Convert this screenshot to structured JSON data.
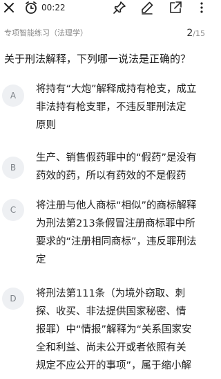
{
  "header": {
    "timer": "00:22",
    "icons": [
      "close-icon",
      "clock-icon",
      "pin-icon",
      "edit-icon",
      "export-icon",
      "more-icon"
    ]
  },
  "subheader": {
    "breadcrumb": "专项智能练习（法理学）",
    "page_current": "2",
    "page_total": "/15"
  },
  "question": {
    "text": "关于刑法解释，下列哪一说法是正确的？"
  },
  "options": [
    {
      "letter": "A",
      "lines": [
        "将持有“大炮”解释成持有枪支，成立",
        "非法持有枪支罪，不违反罪刑法定",
        "原则"
      ]
    },
    {
      "letter": "B",
      "lines": [
        "生产、销售假药罪中的“假药”是没有",
        "药效的药，所以有药效的不是假药"
      ]
    },
    {
      "letter": "C",
      "lines": [
        "将注册与他人商标“相似”的商标解释",
        "为刑法第213条假冒注册商标罪中所",
        "要求的“注册相同商标”，违反罪刑法",
        "定"
      ]
    },
    {
      "letter": "D",
      "lines": [
        "将刑法第111条（为境外窃取、刺",
        "探、收买、非法提供国家秘密、情",
        "报罪）中“情报”解释为“关系国家安",
        "全和利益、尚未公开或者依照有关",
        "规定不应公开的事项”，属于缩小解"
      ]
    }
  ],
  "colors": {
    "text": "#222222",
    "muted": "#8a8a8a",
    "badge_bg": "#eef0f3",
    "badge_text": "#7e8389"
  }
}
